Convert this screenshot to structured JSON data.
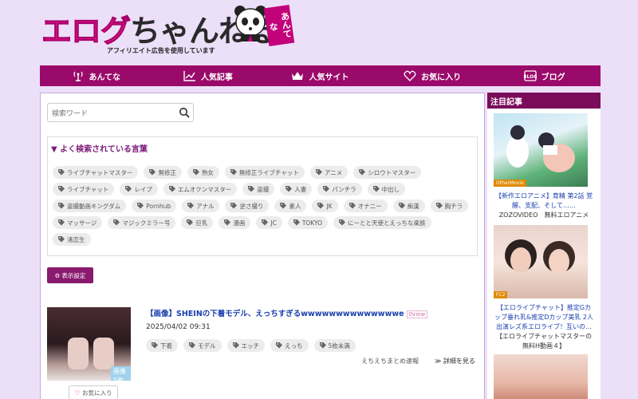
{
  "header": {
    "logo_main": "エログ",
    "logo_sub": "ちゃんねる",
    "logo_tag": "あんてな",
    "tagline": "アフィリエイト広告を使用しています"
  },
  "nav": [
    {
      "label": "あんてな",
      "icon": "antenna-icon"
    },
    {
      "label": "人気記事",
      "icon": "chart-icon"
    },
    {
      "label": "人気サイト",
      "icon": "crown-icon"
    },
    {
      "label": "お気に入り",
      "icon": "heart-icon"
    },
    {
      "label": "ブログ",
      "icon": "blog-icon"
    }
  ],
  "search": {
    "placeholder": "検索ワード",
    "icon": "search-icon"
  },
  "popular": {
    "title": "▼ よく検索されている言葉",
    "tags": [
      "ライブチャットマスター",
      "無修正",
      "熟女",
      "無修正ライブチャット",
      "アニメ",
      "シロウトマスター",
      "ライブチャット",
      "レイプ",
      "エムオクンマスター",
      "盗撮",
      "人妻",
      "パンチラ",
      "中出し",
      "盗撮動画キングダム",
      "Pornhub",
      "アナル",
      "逆さ撮り",
      "素人",
      "JK",
      "オナニー",
      "痴漢",
      "胸チラ",
      "マッサージ",
      "マジックミラー号",
      "巨乳",
      "漫画",
      "JC",
      "TOKYO",
      "にーとと天使とえっちな楽族",
      "渚恋生"
    ]
  },
  "display_settings": {
    "label": "表示設定"
  },
  "article": {
    "title": "【画像】SHEINの下着モデル、えっちすぎるwwwwwwwwwwwwwwe",
    "view_badge": "0view",
    "date": "2025/04/02 09:31",
    "image_badge": "画像5枚",
    "tags": [
      "下着",
      "モデル",
      "エッチ",
      "えっち",
      "5枚未満"
    ],
    "source": "えちえちまとめ速報",
    "more": "≫ 詳細を見る",
    "fav": "お気に入り"
  },
  "sidebar": {
    "title": "注目記事",
    "items": [
      {
        "label": "OtherMovie",
        "text": "【新作エロアニメ】育精 第2話 覚醒、支配、そして……",
        "extra": "ZOZOVIDEO　無料エロアニメ"
      },
      {
        "label": "FC2",
        "text": "【エロライブチャット】推定Gカップ垂れ乳&推定Dカップ美乳 2人出演レズ系エロライブ！互いの…",
        "extra": "【エロライブチャットマスターの無料H動画４】"
      }
    ]
  },
  "colors": {
    "brand": "#e8198b",
    "nav": "#9a0a6a",
    "link": "#1a3faf",
    "background": "#ecdff8"
  }
}
